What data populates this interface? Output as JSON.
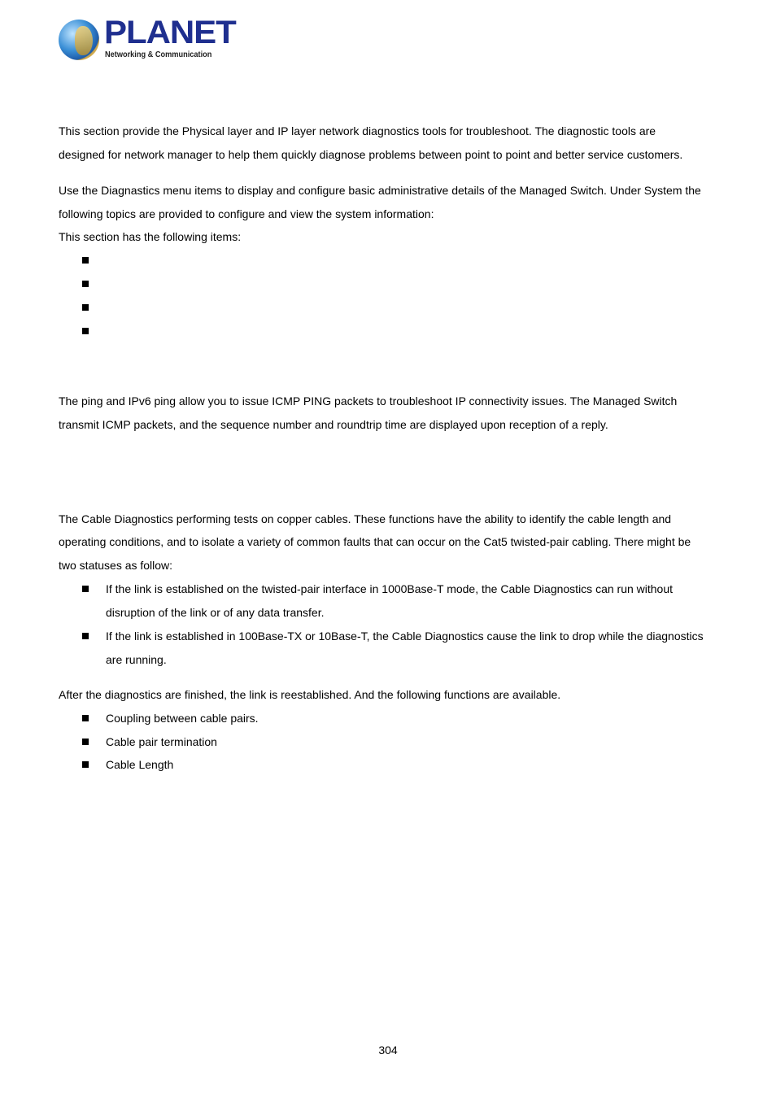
{
  "header": {
    "logo": {
      "brand": "PLANET",
      "tagline": "Networking & Communication"
    }
  },
  "intro": {
    "paragraph1": [
      "This section provide the Physical layer and IP layer network diagnostics tools for troubleshoot. The diagnostic tools are",
      "designed for network manager to help them quickly diagnose problems between point to point and better service customers."
    ],
    "paragraph2": [
      "Use the Diagnastics menu items to display and configure basic administrative details of the Managed Switch. Under System the",
      "following topics are provided to configure and view the system information:"
    ],
    "items_intro": "This section has the following items:",
    "items": [
      "",
      "",
      "",
      ""
    ]
  },
  "ping": {
    "paragraph": [
      "The ping and IPv6 ping allow you to issue ICMP PING packets to troubleshoot IP connectivity issues. The Managed Switch",
      "transmit ICMP packets, and the sequence number and roundtrip time are displayed upon reception of a reply."
    ]
  },
  "cable": {
    "paragraph": [
      "The Cable Diagnostics performing tests on copper cables. These functions have the ability to identify the cable length and",
      "operating conditions, and to isolate a variety of common faults that can occur on the Cat5 twisted-pair cabling. There might be",
      "two statuses as follow:"
    ],
    "statuses": [
      [
        "If the link is established on the twisted-pair interface in 1000Base-T mode, the Cable Diagnostics can run without",
        "disruption of the link or of any data transfer."
      ],
      [
        "If the link is established in 100Base-TX or 10Base-T, the Cable Diagnostics cause the link to drop while the diagnostics",
        "are running."
      ]
    ],
    "after": "After the diagnostics are finished, the link is reestablished. And the following functions are available.",
    "functions": [
      "Coupling between cable pairs.",
      "Cable pair termination",
      "Cable Length"
    ]
  },
  "footer": {
    "page_number": "304"
  }
}
